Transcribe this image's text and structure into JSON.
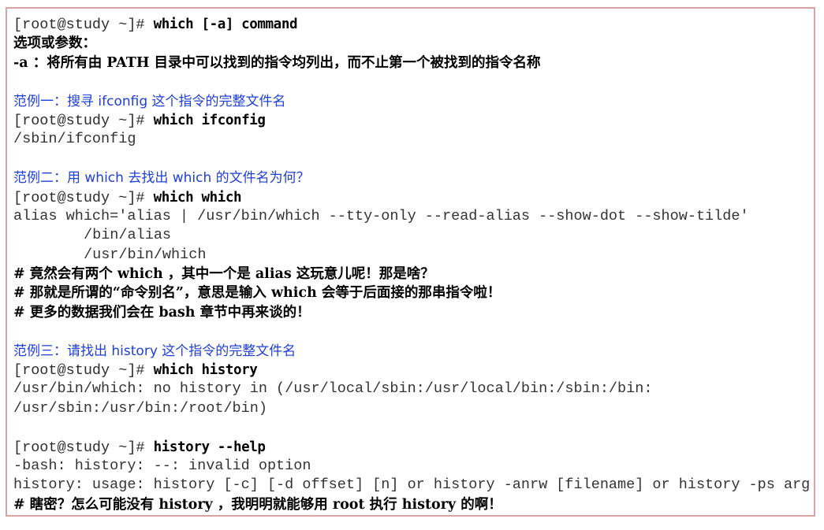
{
  "prompt": "[root@study ~]#",
  "lines": {
    "cmd1": "which [-a] command",
    "opt_header": "选项或参数：",
    "opt_a": "-a ：将所有由 PATH 目录中可以找到的指令均列出，而不止第一个被找到的指令名称",
    "ex1_title": "范例一：搜寻 ifconfig 这个指令的完整文件名",
    "ex1_cmd": "which ifconfig",
    "ex1_out": "/sbin/ifconfig",
    "ex2_title": "范例二：用 which 去找出 which 的文件名为何？",
    "ex2_cmd": "which which",
    "ex2_out1": "alias which='alias | /usr/bin/which --tty-only --read-alias --show-dot --show-tilde'",
    "ex2_out2": "/bin/alias",
    "ex2_out3": "/usr/bin/which",
    "ex2_c1": "# 竟然会有两个 which ，其中一个是 alias 这玩意儿呢！那是啥？",
    "ex2_c2": "# 那就是所谓的“命令别名”，意思是输入 which 会等于后面接的那串指令啦！",
    "ex2_c3": "# 更多的数据我们会在 bash 章节中再来谈的！",
    "ex3_title": "范例三：请找出 history 这个指令的完整文件名",
    "ex3_cmd": "which history",
    "ex3_out1": "/usr/bin/which: no history in (/usr/local/sbin:/usr/local/bin:/sbin:/bin:",
    "ex3_out2": "/usr/sbin:/usr/bin:/root/bin)",
    "ex4_cmd": "history --help",
    "ex4_out1": "-bash: history: --: invalid option",
    "ex4_out2": "history: usage: history [-c] [-d offset] [n] or history -anrw [filename] or history -ps arg",
    "ex4_c1": "# 瞎密？怎么可能没有 history ，我明明就能够用 root 执行 history 的啊！"
  }
}
